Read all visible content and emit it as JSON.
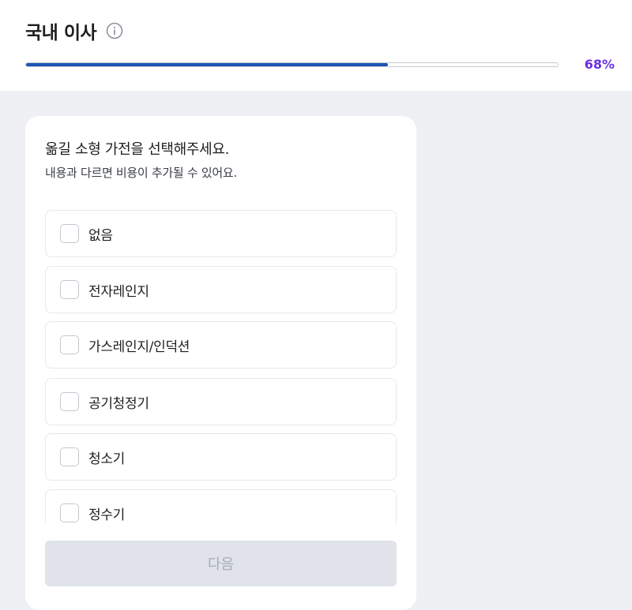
{
  "header": {
    "title": "국내 이사",
    "info_icon": "info-circle-icon",
    "progress": {
      "percent": 68,
      "label": "68%"
    },
    "colors": {
      "progress_fill": "#1a56b4",
      "percent_text": "#6a2fe0"
    }
  },
  "card": {
    "question": "옮길 소형 가전을 선택해주세요.",
    "subtext": "내용과 다르면 비용이 추가될 수 있어요.",
    "options": [
      {
        "label": "없음",
        "checked": false
      },
      {
        "label": "전자레인지",
        "checked": false
      },
      {
        "label": "가스레인지/인덕션",
        "checked": false
      },
      {
        "label": "공기청정기",
        "checked": false
      },
      {
        "label": "청소기",
        "checked": false
      },
      {
        "label": "정수기",
        "checked": false
      }
    ],
    "next_label": "다음"
  }
}
